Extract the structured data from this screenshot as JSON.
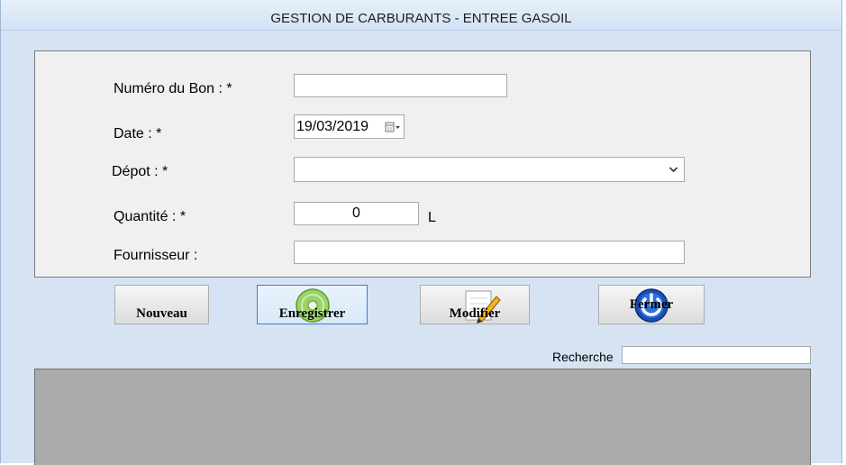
{
  "window": {
    "title": "GESTION DE CARBURANTS - ENTREE GASOIL"
  },
  "form": {
    "numero_label": "Numéro du Bon : *",
    "numero_value": "",
    "date_label": "Date : *",
    "date_value": "19/03/2019",
    "depot_label": "Dépot : *",
    "depot_value": "",
    "quantite_label": "Quantité : *",
    "quantite_value": "0",
    "quantite_unit": "L",
    "fournisseur_label": "Fournisseur :",
    "fournisseur_value": ""
  },
  "buttons": {
    "nouveau": "Nouveau",
    "enregistrer": "Enregistrer",
    "modifier": "Modifier",
    "fermer": "Fermer"
  },
  "search": {
    "label": "Recherche",
    "value": ""
  },
  "icons": {
    "enregistrer": "disc-icon",
    "modifier": "pencil-icon",
    "fermer": "power-icon",
    "date": "calendar-icon"
  },
  "colors": {
    "window_bg": "#d5e3f2",
    "panel_bg": "#f0f0f0",
    "grid_bg": "#ababab",
    "focus_border": "#3c7fd1"
  }
}
